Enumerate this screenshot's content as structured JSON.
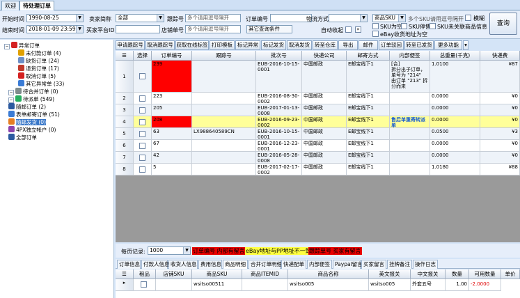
{
  "window_tabs": [
    {
      "label": "欢迎"
    },
    {
      "label": "待处理订单"
    }
  ],
  "filters": {
    "start_label": "开始时间",
    "start_value": "1990-08-25",
    "end_label": "结束时间",
    "end_value": "2018-01-09 23:59:5",
    "seller_label": "卖家简称",
    "seller_value": "全部",
    "platform_label": "买家平台ID",
    "tracking_label": "跟踪号",
    "tracking_ph": "多个请用逗号隔开",
    "order_label": "订单编号",
    "store_label": "店铺单号",
    "store_ph": "多个请用逗号隔开",
    "other_label": "其它查询条件",
    "logistics_label": "物流方式",
    "auto_label": "自动收起",
    "sku_select": "商品SKU",
    "sku_ph": "多个SKU请用逗号隔开",
    "fuzzy_label": "模糊",
    "cb_sku_empty": "SKU为空",
    "cb_sku_stop": "SKU停售",
    "cb_sku_unlinked": "SKU未关联商品信息",
    "cb_ebay_addr": "eBay收货地址为空",
    "query_button": "查询"
  },
  "tree": [
    {
      "label": "异常订单",
      "color": "#d42020"
    },
    {
      "label": "未付款订单 (4)",
      "color": "#e0a000"
    },
    {
      "label": "缺货订单 (24)",
      "color": "#6c8fc7"
    },
    {
      "label": "退货订单 (17)",
      "color": "#c0392b"
    },
    {
      "label": "取消订单 (5)",
      "color": "#d42020"
    },
    {
      "label": "其它异常单 (33)",
      "color": "#3a7bd5"
    },
    {
      "label": "待合并订单 (0)",
      "color": "#7f8c8d"
    },
    {
      "label": "待派单 (549)",
      "color": "#27ae60"
    },
    {
      "label": "随邮订单 (2)",
      "color": "#2c5aa0"
    },
    {
      "label": "表单邮寄订单 (51)",
      "color": "#3a7bd5"
    },
    {
      "label": "随邮发货 (0)",
      "color": "#e67e22"
    },
    {
      "label": "4PX独立帐户 (0)",
      "color": "#8e44ad"
    },
    {
      "label": "全部订单",
      "color": "#2c5aa0"
    }
  ],
  "toolbar": [
    "申请跟踪号",
    "取消跟踪号",
    "获取在线标签",
    "打印模板",
    "标记异常",
    "标记发货",
    "取消发货",
    "转至仓库",
    "导出",
    "邮件",
    "订单驳回",
    "转至已发货",
    "更多功能"
  ],
  "grid": {
    "headers": [
      "选择",
      "订单编号",
      "跟踪号",
      "批次号",
      "快递公司",
      "邮寄方式",
      "内部便签",
      "总重量(千克)",
      "快递费"
    ],
    "rows": [
      {
        "num": "1",
        "order": "239",
        "tracking": "",
        "batch": "EUB-2016-10-15-0001",
        "company": "中国邮政",
        "method": "E邮宝线下1",
        "note": "[合]\n拆分出子订单，单号为 \"214\"\n由订单 \"213\" 拆分而来",
        "weight": "1.0100",
        "fee": "¥87"
      },
      {
        "num": "2",
        "order": "223",
        "tracking": "",
        "batch": "EUB-2016-08-30-0002",
        "company": "中国邮政",
        "method": "E邮宝线下1",
        "note": "",
        "weight": "0.0000",
        "fee": "¥0"
      },
      {
        "num": "3",
        "order": "205",
        "tracking": "",
        "batch": "EUB-2017-01-13-0008",
        "company": "中国邮政",
        "method": "E邮宝线下1",
        "note": "",
        "weight": "0.0000",
        "fee": "¥0"
      },
      {
        "num": "4",
        "order": "208",
        "tracking": "",
        "batch": "EUB-2016-09-23-0002",
        "company": "中国邮政",
        "method": "E邮宝线下1",
        "note": "售后单重寄转派单",
        "weight": "0.0000",
        "fee": "¥0"
      },
      {
        "num": "5",
        "order": "63",
        "tracking": "LX988640589CN",
        "batch": "EUB-2016-10-15-0001",
        "company": "中国邮政",
        "method": "E邮宝线下1",
        "note": "",
        "weight": "0.0500",
        "fee": "¥3"
      },
      {
        "num": "6",
        "order": "67",
        "tracking": "",
        "batch": "EUB-2016-12-23-0001",
        "company": "中国邮政",
        "method": "E邮宝线下1",
        "note": "",
        "weight": "0.0000",
        "fee": "¥0"
      },
      {
        "num": "7",
        "order": "42",
        "tracking": "",
        "batch": "EUB-2016-05-28-0008",
        "company": "中国邮政",
        "method": "E邮宝线下1",
        "note": "",
        "weight": "0.0000",
        "fee": "¥0"
      },
      {
        "num": "8",
        "order": "5",
        "tracking": "",
        "batch": "EUB-2017-02-17-0002",
        "company": "中国邮政",
        "method": "E邮宝线下1",
        "note": "",
        "weight": "1.0180",
        "fee": "¥88"
      }
    ]
  },
  "bottom": {
    "per_page_label": "每页记录:",
    "per_page_value": "1000",
    "legend1": "订单编号 内部有留言",
    "legend2": "eBay地址与PP地址不一致",
    "legend3": "跟踪单号 买家有留言"
  },
  "detail_tabs": [
    "订单信息",
    "付款人信息",
    "收货人信息",
    "费用信息",
    "商品明细",
    "合并订单明细",
    "快递配单",
    "内部便签",
    "Paypal留言",
    "买家留言",
    "挂牌备注",
    "操作日志"
  ],
  "detail": {
    "headers": [
      "租品",
      "店铺SKU",
      "商品SKU",
      "商品ITEMID",
      "商品名称",
      "英文报关",
      "中文报关",
      "数量",
      "可用数量",
      "单价"
    ],
    "row": {
      "store_sku": "",
      "sku": "wsitso00511",
      "itemid": "",
      "name": "wsitso005",
      "en_decl": "wsitso005",
      "cn_decl": "外套五号",
      "qty": "1.00",
      "avail": "-2.0000"
    }
  }
}
